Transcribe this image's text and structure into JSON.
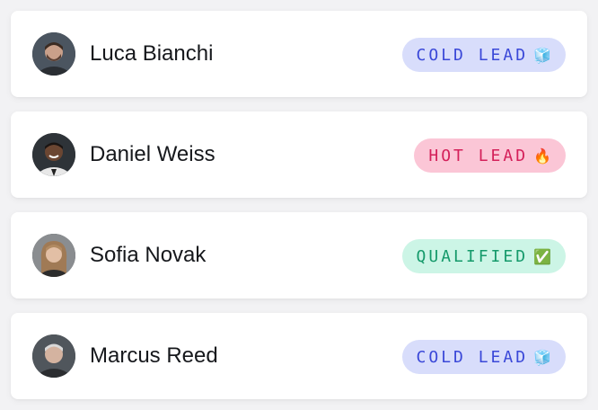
{
  "leads": [
    {
      "name": "Luca Bianchi",
      "avatar_icon": "avatar-man-beard",
      "status": {
        "label": "COLD LEAD",
        "emoji": "🧊",
        "bg": "#d8ddfb",
        "fg": "#3a48d8"
      }
    },
    {
      "name": "Daniel Weiss",
      "avatar_icon": "avatar-man-smiling",
      "status": {
        "label": "HOT LEAD",
        "emoji": "🔥",
        "bg": "#fbc6d6",
        "fg": "#d4205a"
      }
    },
    {
      "name": "Sofia Novak",
      "avatar_icon": "avatar-woman",
      "status": {
        "label": "QUALIFIED",
        "emoji": "✅",
        "bg": "#ccf5e6",
        "fg": "#159a6b"
      }
    },
    {
      "name": "Marcus Reed",
      "avatar_icon": "avatar-man-older",
      "status": {
        "label": "COLD LEAD",
        "emoji": "🧊",
        "bg": "#d8ddfb",
        "fg": "#3a48d8"
      }
    }
  ]
}
